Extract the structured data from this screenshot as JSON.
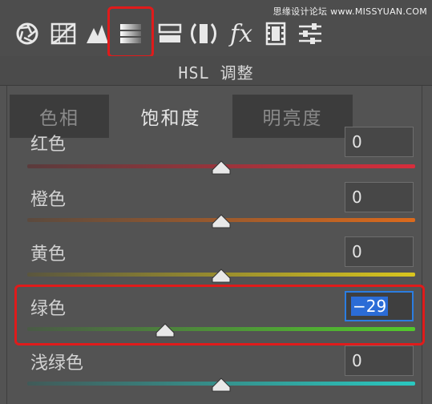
{
  "watermark": "思缘设计论坛 www.MISSYUAN.COM",
  "toolbar": {
    "tools": [
      "basic-aperture-icon",
      "tone-curve-icon",
      "detail-icon",
      "hsl-grayscale-icon",
      "split-toning-icon",
      "lens-correction-icon",
      "effects-fx-icon",
      "camera-calibration-icon",
      "presets-icon"
    ],
    "fx_label": "fx",
    "selected_tool": "hsl-grayscale-icon",
    "highlight_color": "#e01b1b"
  },
  "panel": {
    "title": "HSL 调整"
  },
  "tabs": [
    {
      "label": "色相",
      "active": false
    },
    {
      "label": "饱和度",
      "active": true
    },
    {
      "label": "明亮度",
      "active": false
    }
  ],
  "sliders": [
    {
      "label": "红色",
      "value": "0",
      "gradient": [
        "#5a3b3c",
        "#d82d3c"
      ]
    },
    {
      "label": "橙色",
      "value": "0",
      "gradient": [
        "#5b4a3e",
        "#dc6a1c"
      ]
    },
    {
      "label": "黄色",
      "value": "0",
      "gradient": [
        "#5a563e",
        "#d9c51e"
      ]
    },
    {
      "label": "绿色",
      "value": "−29",
      "focused": true,
      "gradient": [
        "#4a5a46",
        "#52c92c"
      ]
    },
    {
      "label": "浅绿色",
      "value": "0",
      "gradient": [
        "#415a58",
        "#2ac8c0"
      ]
    }
  ],
  "colors": {
    "focus_blue": "#2b7de1",
    "annotation_red": "#e01b1b"
  }
}
